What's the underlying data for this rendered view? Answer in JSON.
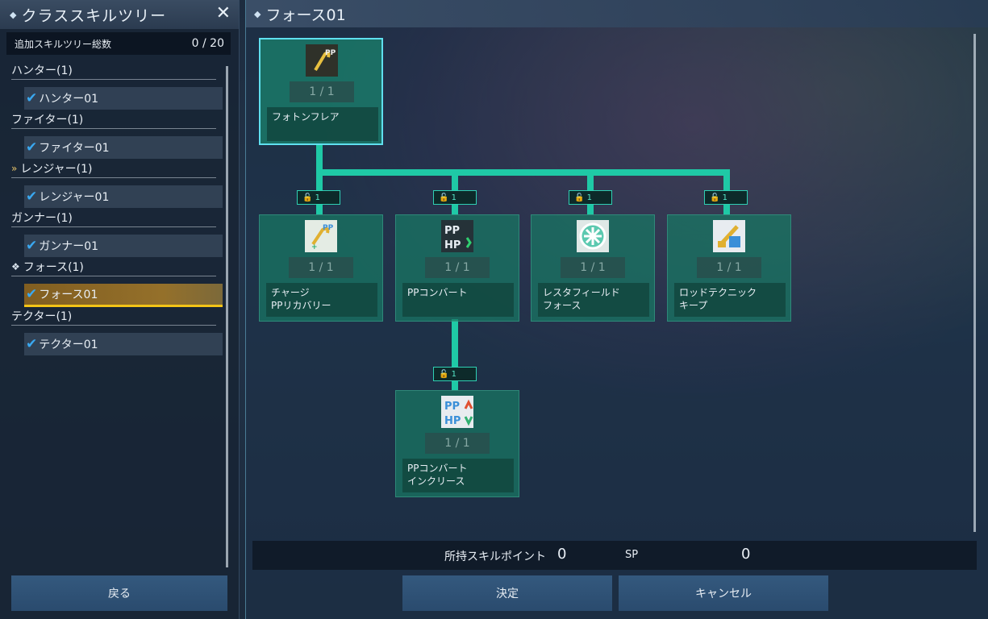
{
  "left_panel": {
    "title": "クラススキルツリー",
    "close_label": "✕",
    "total_label": "追加スキルツリー総数",
    "total_value": "0 / 20",
    "classes": [
      {
        "name": "ハンター(1)",
        "tree": "ハンター01",
        "badge": ""
      },
      {
        "name": "ファイター(1)",
        "tree": "ファイター01",
        "badge": ""
      },
      {
        "name": "レンジャー(1)",
        "tree": "レンジャー01",
        "badge": "sub-class-icon"
      },
      {
        "name": "ガンナー(1)",
        "tree": "ガンナー01",
        "badge": ""
      },
      {
        "name": "フォース(1)",
        "tree": "フォース01",
        "badge": "main-class-icon"
      },
      {
        "name": "テクター(1)",
        "tree": "テクター01",
        "badge": ""
      }
    ],
    "selected_index": 4,
    "back_label": "戻る"
  },
  "right_panel": {
    "title": "フォース01",
    "skills": [
      {
        "id": "photon-flare",
        "name": "フォトンフレア",
        "level": "1 / 1",
        "icon": "rod-pp-icon"
      },
      {
        "id": "charge-pp-recovery",
        "name": "チャージ\nPPリカバリー",
        "level": "1 / 1",
        "icon": "rod-charge-icon"
      },
      {
        "id": "pp-convert",
        "name": "PPコンバート",
        "level": "1 / 1",
        "icon": "pp-hp-convert-icon"
      },
      {
        "id": "resta-field-force",
        "name": "レスタフィールド\nフォース",
        "level": "1 / 1",
        "icon": "resta-field-icon"
      },
      {
        "id": "rod-technic-keep",
        "name": "ロッドテクニック\nキープ",
        "level": "1 / 1",
        "icon": "rod-technic-icon"
      },
      {
        "id": "pp-convert-increase",
        "name": "PPコンバート\nインクリース",
        "level": "1 / 1",
        "icon": "pp-hp-increase-icon"
      }
    ],
    "lock_tag_label": "1",
    "sp_label": "所持スキルポイント",
    "sp_owned": "0",
    "sp_unit": "SP",
    "sp_value": "0",
    "confirm_label": "決定",
    "cancel_label": "キャンセル"
  },
  "colors": {
    "connector": "#1fc9a6",
    "node_bg": "#187864",
    "selected_accent": "#f3c417",
    "check": "#3aa8f0"
  }
}
